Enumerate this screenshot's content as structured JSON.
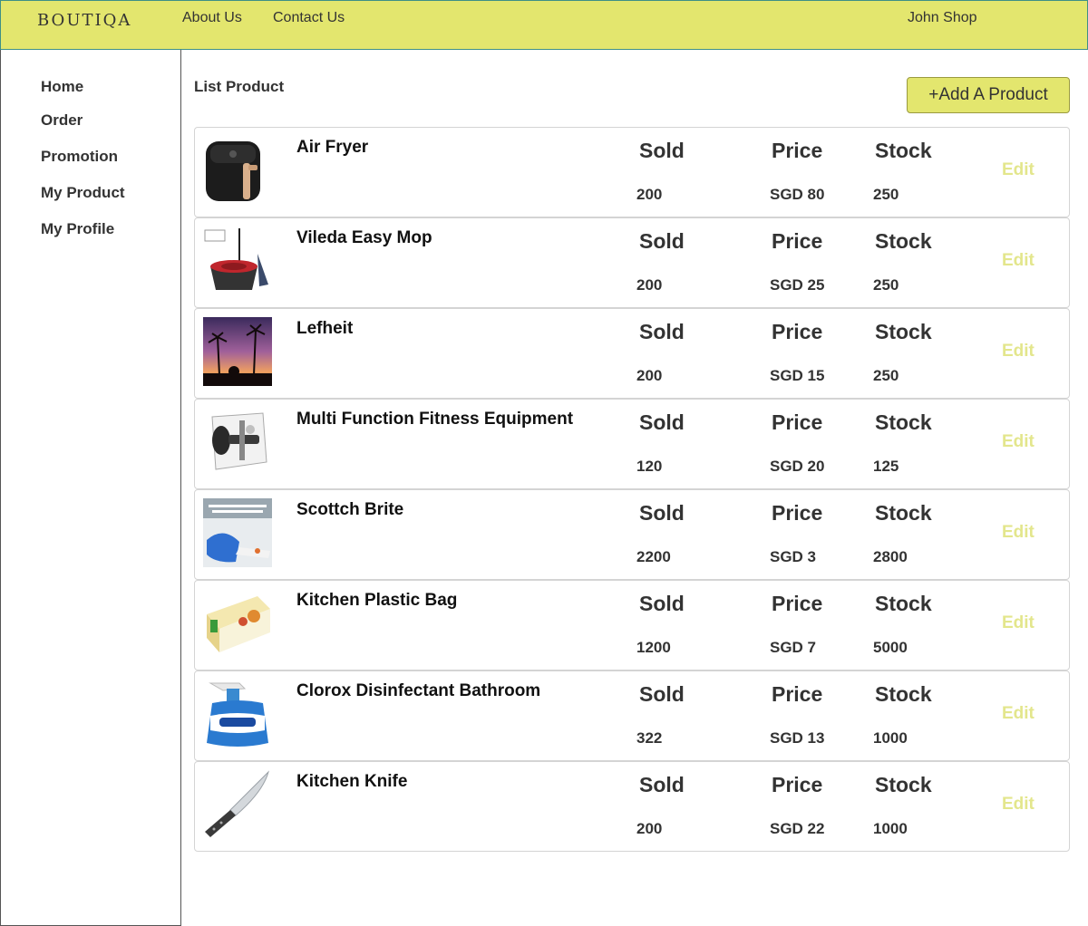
{
  "header": {
    "logo": "BOUTIQA",
    "nav": [
      "About Us",
      "Contact Us"
    ],
    "user": "John Shop",
    "bg_color": "#e3e66e"
  },
  "sidebar": {
    "items": [
      "Home",
      "Order",
      "Promotion",
      "My Product",
      "My Profile"
    ]
  },
  "main": {
    "title": "List Product",
    "add_button": "+Add A Product",
    "columns": {
      "sold": "Sold",
      "price": "Price",
      "stock": "Stock"
    },
    "edit_label": "Edit",
    "products": [
      {
        "name": "Air Fryer",
        "sold": "200",
        "price": "SGD 80",
        "stock": "250",
        "image": "air-fryer-image"
      },
      {
        "name": "Vileda Easy Mop",
        "sold": "200",
        "price": "SGD 25",
        "stock": "250",
        "image": "mop-image"
      },
      {
        "name": "Lefheit",
        "sold": "200",
        "price": "SGD 15",
        "stock": "250",
        "image": "sunset-palm-image"
      },
      {
        "name": "Multi Function Fitness Equipment",
        "sold": "120",
        "price": "SGD 20",
        "stock": "125",
        "image": "fitness-equipment-image"
      },
      {
        "name": "Scottch Brite",
        "sold": "2200",
        "price": "SGD 3",
        "stock": "2800",
        "image": "sponge-image"
      },
      {
        "name": "Kitchen Plastic Bag",
        "sold": "1200",
        "price": "SGD 7",
        "stock": "5000",
        "image": "plastic-bag-box-image"
      },
      {
        "name": "Clorox Disinfectant Bathroom",
        "sold": "322",
        "price": "SGD 13",
        "stock": "1000",
        "image": "spray-bottle-image"
      },
      {
        "name": "Kitchen Knife",
        "sold": "200",
        "price": "SGD 22",
        "stock": "1000",
        "image": "knife-image"
      }
    ]
  }
}
